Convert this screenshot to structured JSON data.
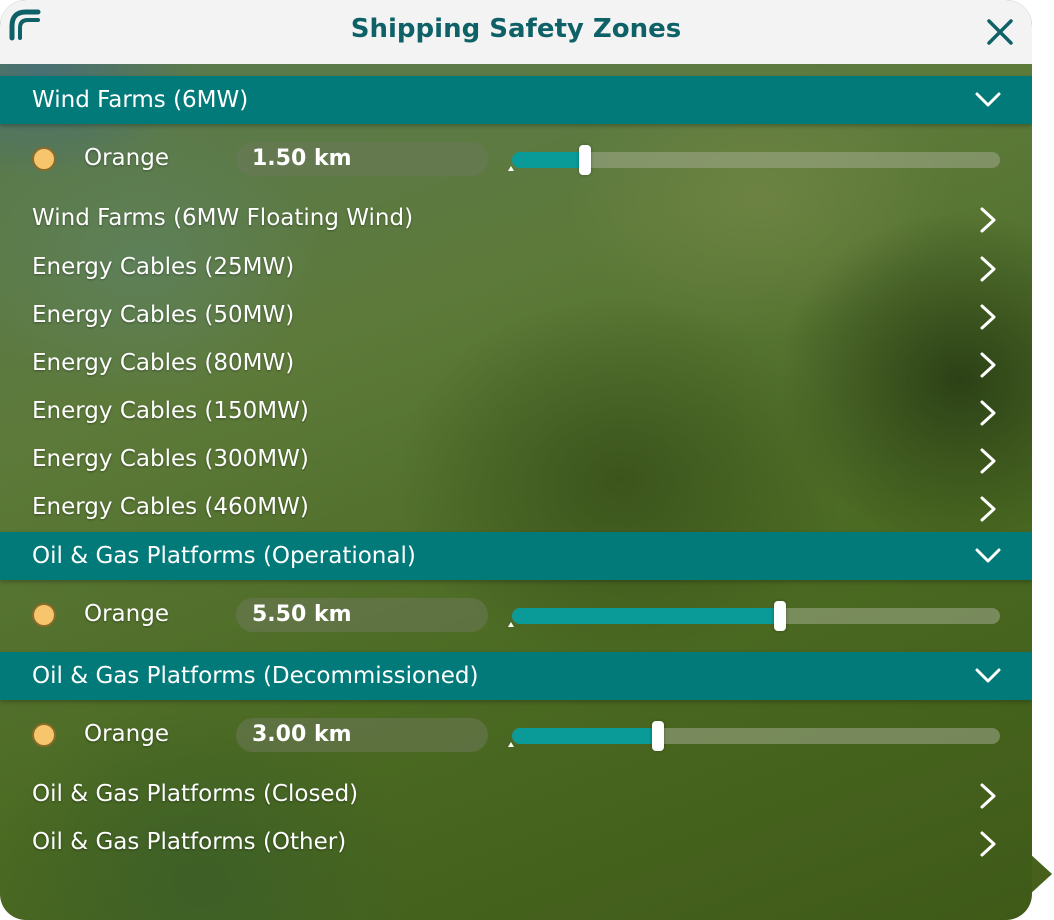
{
  "header": {
    "title": "Shipping Safety Zones",
    "logo_icon": "app-logo-icon",
    "close_icon": "close-icon"
  },
  "colors": {
    "accent": "#037a7a",
    "title": "#0f6168",
    "dot": "#f7c56b",
    "slider_fill": "#0a9a98"
  },
  "sections": [
    {
      "label": "Wind Farms (6MW)",
      "expanded": true,
      "zone": {
        "color_label": "Orange",
        "value": "1.50 km",
        "slider_fraction": 0.15
      },
      "items": [
        "Wind Farms (6MW Floating Wind)",
        "Energy Cables (25MW)",
        "Energy Cables (50MW)",
        "Energy Cables (80MW)",
        "Energy Cables (150MW)",
        "Energy Cables (300MW)",
        "Energy Cables (460MW)"
      ]
    },
    {
      "label": "Oil & Gas Platforms (Operational)",
      "expanded": true,
      "zone": {
        "color_label": "Orange",
        "value": "5.50 km",
        "slider_fraction": 0.55
      },
      "items": []
    },
    {
      "label": "Oil & Gas Platforms (Decommissioned)",
      "expanded": true,
      "zone": {
        "color_label": "Orange",
        "value": "3.00 km",
        "slider_fraction": 0.3
      },
      "items": [
        "Oil & Gas Platforms (Closed)",
        "Oil & Gas Platforms (Other)"
      ]
    }
  ]
}
